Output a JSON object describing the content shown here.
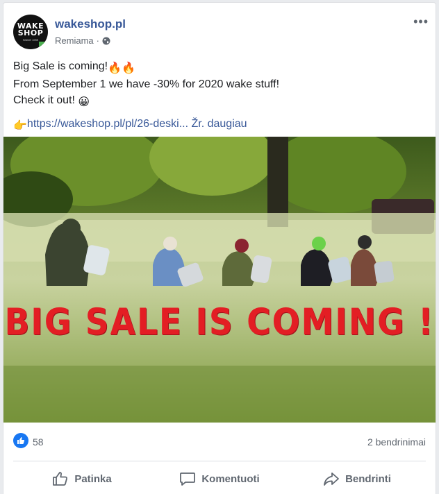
{
  "post": {
    "page_name": "wakeshop.pl",
    "sponsored_label": "Remiama",
    "separator": "·",
    "avatar": {
      "logo_line1": "WAKE",
      "logo_line2": "SHOP",
      "logo_sub": "SINCE 1999"
    },
    "text_line1": "Big Sale is coming!",
    "text_line2": "From September 1 we have -30% for 2020 wake stuff!",
    "text_line3": "Check it out!",
    "emoji_fire": "🔥🔥",
    "emoji_grin": "😀",
    "emoji_point": "👉",
    "link_text": "https://wakeshop.pl/pl/26-deski...",
    "see_more": "Žr. daugiau",
    "image_caption": "BIG SALE IS COMING !",
    "likes_count": "58",
    "shares": "2 bendrinimai"
  },
  "actions": {
    "like": "Patinka",
    "comment": "Komentuoti",
    "share": "Bendrinti"
  },
  "icons": {
    "more": "more-options-icon",
    "globe": "globe-icon",
    "like_reaction": "like-reaction-icon",
    "like_action": "thumbs-up-icon",
    "comment_action": "comment-icon",
    "share_action": "share-icon"
  },
  "colors": {
    "link_blue": "#385898",
    "reaction_blue": "#1877f2",
    "sale_red": "#e31e24",
    "muted_text": "#606770"
  }
}
